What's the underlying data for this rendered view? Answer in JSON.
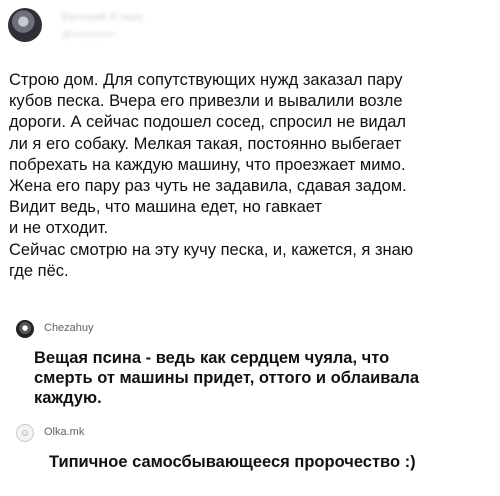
{
  "post": {
    "author_name": "Евгений Р-ных",
    "author_subtitle": "@ivkmnbm",
    "lines": [
      "Строю дом. Для сопутствующих нужд заказал пару",
      "кубов песка. Вчера его привезли и вывалили возле",
      "дороги. А сейчас подошел сосед, спросил не видал",
      "ли я его собаку. Мелкая такая,  постоянно выбегает",
      "побрехать на каждую машину, что проезжает мимо.",
      "Жена его пару раз чуть не задавила, сдавая задом.",
      "Видит ведь, что машина едет, но гавкает",
      "и не отходит.",
      "Сейчас смотрю на эту кучу песка, и, кажется, я знаю",
      "где пёс."
    ]
  },
  "comments": [
    {
      "username": "Chezahuy",
      "lines": [
        "Вещая псина - ведь как сердцем чуяла, что",
        "смерть от машины придет, оттого и облаивала",
        "каждую."
      ]
    },
    {
      "username": "Olka.mk",
      "lines": [
        "Типичное самосбывающееся пророчество :)"
      ]
    }
  ]
}
